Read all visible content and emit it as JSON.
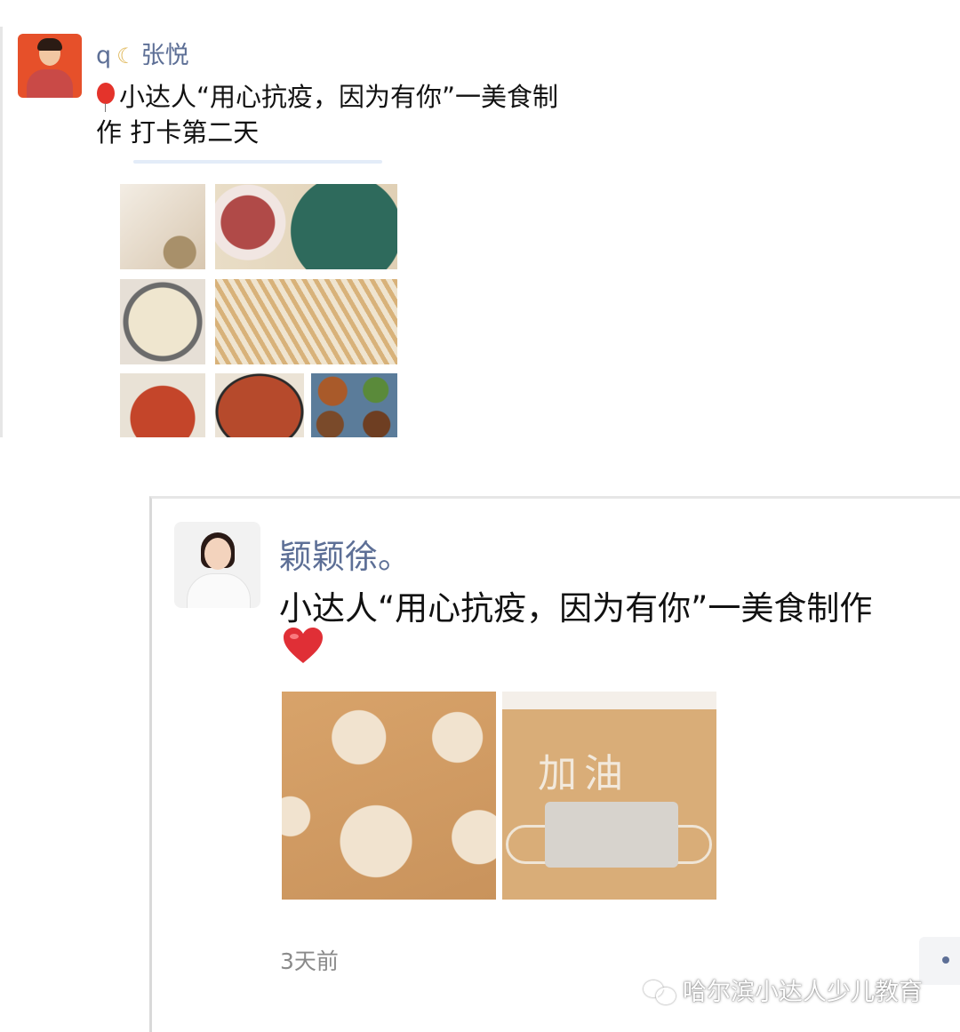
{
  "post1": {
    "name_prefix": "q",
    "name": "张悦",
    "line1": "小达人“用心抗疫，因为有你”一美食制",
    "line2": "作 打卡第二天",
    "photos": [
      "photo-1",
      "photo-2",
      "photo-3",
      "photo-4",
      "photo-5",
      "photo-6",
      "photo-7"
    ]
  },
  "post2": {
    "name": "颖颖徐。",
    "text": "小达人“用心抗疫，因为有你”一美食制作",
    "photo_text": "加油",
    "time": "3天前"
  },
  "watermark": "哈尔滨小达人少儿教育",
  "colors": {
    "name_link": "#5d6f96",
    "heart": "#e02f36",
    "balloon": "#e4332b"
  }
}
